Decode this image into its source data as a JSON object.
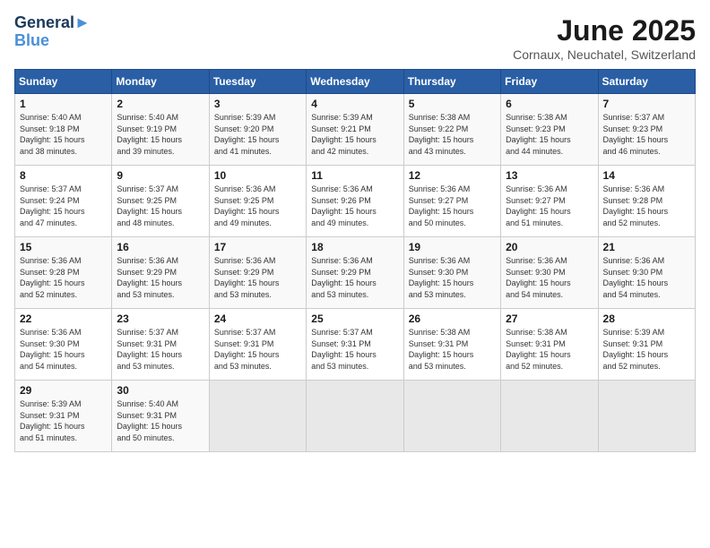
{
  "header": {
    "logo_line1": "General",
    "logo_line2": "Blue",
    "title": "June 2025",
    "subtitle": "Cornaux, Neuchatel, Switzerland"
  },
  "weekdays": [
    "Sunday",
    "Monday",
    "Tuesday",
    "Wednesday",
    "Thursday",
    "Friday",
    "Saturday"
  ],
  "weeks": [
    [
      {
        "day": "1",
        "info": "Sunrise: 5:40 AM\nSunset: 9:18 PM\nDaylight: 15 hours\nand 38 minutes."
      },
      {
        "day": "2",
        "info": "Sunrise: 5:40 AM\nSunset: 9:19 PM\nDaylight: 15 hours\nand 39 minutes."
      },
      {
        "day": "3",
        "info": "Sunrise: 5:39 AM\nSunset: 9:20 PM\nDaylight: 15 hours\nand 41 minutes."
      },
      {
        "day": "4",
        "info": "Sunrise: 5:39 AM\nSunset: 9:21 PM\nDaylight: 15 hours\nand 42 minutes."
      },
      {
        "day": "5",
        "info": "Sunrise: 5:38 AM\nSunset: 9:22 PM\nDaylight: 15 hours\nand 43 minutes."
      },
      {
        "day": "6",
        "info": "Sunrise: 5:38 AM\nSunset: 9:23 PM\nDaylight: 15 hours\nand 44 minutes."
      },
      {
        "day": "7",
        "info": "Sunrise: 5:37 AM\nSunset: 9:23 PM\nDaylight: 15 hours\nand 46 minutes."
      }
    ],
    [
      {
        "day": "8",
        "info": "Sunrise: 5:37 AM\nSunset: 9:24 PM\nDaylight: 15 hours\nand 47 minutes."
      },
      {
        "day": "9",
        "info": "Sunrise: 5:37 AM\nSunset: 9:25 PM\nDaylight: 15 hours\nand 48 minutes."
      },
      {
        "day": "10",
        "info": "Sunrise: 5:36 AM\nSunset: 9:25 PM\nDaylight: 15 hours\nand 49 minutes."
      },
      {
        "day": "11",
        "info": "Sunrise: 5:36 AM\nSunset: 9:26 PM\nDaylight: 15 hours\nand 49 minutes."
      },
      {
        "day": "12",
        "info": "Sunrise: 5:36 AM\nSunset: 9:27 PM\nDaylight: 15 hours\nand 50 minutes."
      },
      {
        "day": "13",
        "info": "Sunrise: 5:36 AM\nSunset: 9:27 PM\nDaylight: 15 hours\nand 51 minutes."
      },
      {
        "day": "14",
        "info": "Sunrise: 5:36 AM\nSunset: 9:28 PM\nDaylight: 15 hours\nand 52 minutes."
      }
    ],
    [
      {
        "day": "15",
        "info": "Sunrise: 5:36 AM\nSunset: 9:28 PM\nDaylight: 15 hours\nand 52 minutes."
      },
      {
        "day": "16",
        "info": "Sunrise: 5:36 AM\nSunset: 9:29 PM\nDaylight: 15 hours\nand 53 minutes."
      },
      {
        "day": "17",
        "info": "Sunrise: 5:36 AM\nSunset: 9:29 PM\nDaylight: 15 hours\nand 53 minutes."
      },
      {
        "day": "18",
        "info": "Sunrise: 5:36 AM\nSunset: 9:29 PM\nDaylight: 15 hours\nand 53 minutes."
      },
      {
        "day": "19",
        "info": "Sunrise: 5:36 AM\nSunset: 9:30 PM\nDaylight: 15 hours\nand 53 minutes."
      },
      {
        "day": "20",
        "info": "Sunrise: 5:36 AM\nSunset: 9:30 PM\nDaylight: 15 hours\nand 54 minutes."
      },
      {
        "day": "21",
        "info": "Sunrise: 5:36 AM\nSunset: 9:30 PM\nDaylight: 15 hours\nand 54 minutes."
      }
    ],
    [
      {
        "day": "22",
        "info": "Sunrise: 5:36 AM\nSunset: 9:30 PM\nDaylight: 15 hours\nand 54 minutes."
      },
      {
        "day": "23",
        "info": "Sunrise: 5:37 AM\nSunset: 9:31 PM\nDaylight: 15 hours\nand 53 minutes."
      },
      {
        "day": "24",
        "info": "Sunrise: 5:37 AM\nSunset: 9:31 PM\nDaylight: 15 hours\nand 53 minutes."
      },
      {
        "day": "25",
        "info": "Sunrise: 5:37 AM\nSunset: 9:31 PM\nDaylight: 15 hours\nand 53 minutes."
      },
      {
        "day": "26",
        "info": "Sunrise: 5:38 AM\nSunset: 9:31 PM\nDaylight: 15 hours\nand 53 minutes."
      },
      {
        "day": "27",
        "info": "Sunrise: 5:38 AM\nSunset: 9:31 PM\nDaylight: 15 hours\nand 52 minutes."
      },
      {
        "day": "28",
        "info": "Sunrise: 5:39 AM\nSunset: 9:31 PM\nDaylight: 15 hours\nand 52 minutes."
      }
    ],
    [
      {
        "day": "29",
        "info": "Sunrise: 5:39 AM\nSunset: 9:31 PM\nDaylight: 15 hours\nand 51 minutes."
      },
      {
        "day": "30",
        "info": "Sunrise: 5:40 AM\nSunset: 9:31 PM\nDaylight: 15 hours\nand 50 minutes."
      },
      {
        "day": "",
        "info": ""
      },
      {
        "day": "",
        "info": ""
      },
      {
        "day": "",
        "info": ""
      },
      {
        "day": "",
        "info": ""
      },
      {
        "day": "",
        "info": ""
      }
    ]
  ]
}
